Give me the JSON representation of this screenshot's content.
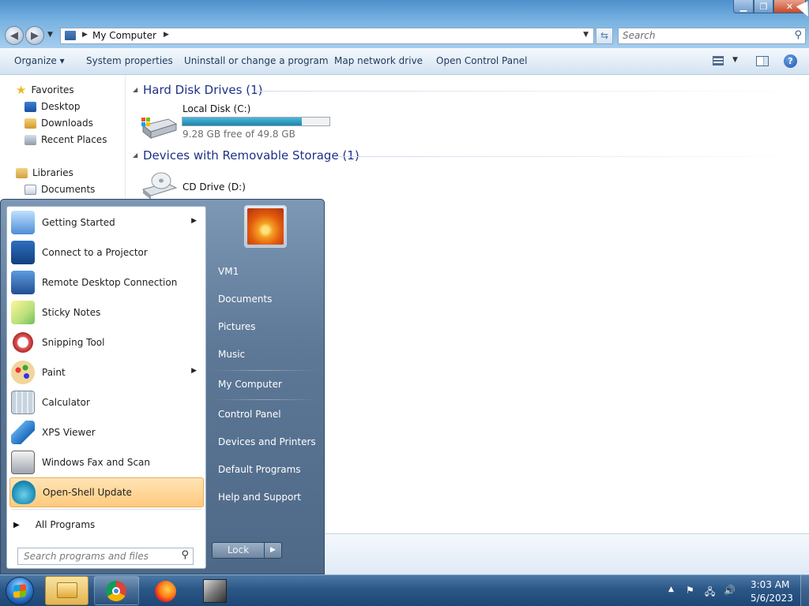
{
  "window": {
    "caption": {
      "minimize": "▁",
      "maximize": "❐",
      "close": "✕"
    },
    "address": {
      "text": "My Computer",
      "sep": "▶",
      "dropdown": "▼"
    },
    "search": {
      "placeholder": "Search"
    },
    "toolbar": {
      "organize": "Organize ▾",
      "system_properties": "System properties",
      "uninstall": "Uninstall or change a program",
      "map_drive": "Map network drive",
      "control_panel": "Open Control Panel"
    },
    "navpane": {
      "favorites": "Favorites",
      "desktop": "Desktop",
      "downloads": "Downloads",
      "recent": "Recent Places",
      "libraries": "Libraries",
      "documents": "Documents"
    },
    "content": {
      "hdd_header": "Hard Disk Drives (1)",
      "local_disk": "Local Disk (C:)",
      "local_disk_free": "9.28 GB free of 49.8 GB",
      "local_disk_used_fraction": 0.814,
      "removable_header": "Devices with Removable Storage (1)",
      "cd_drive": "CD Drive (D:)"
    }
  },
  "startmenu": {
    "programs": [
      {
        "label": "Getting Started",
        "has_submenu": true
      },
      {
        "label": "Connect to a Projector"
      },
      {
        "label": "Remote Desktop Connection"
      },
      {
        "label": "Sticky Notes"
      },
      {
        "label": "Snipping Tool"
      },
      {
        "label": "Paint",
        "has_submenu": true
      },
      {
        "label": "Calculator"
      },
      {
        "label": "XPS Viewer"
      },
      {
        "label": "Windows Fax and Scan"
      },
      {
        "label": "Open-Shell Update",
        "highlighted": true
      }
    ],
    "all_programs": "All Programs",
    "search_placeholder": "Search programs and files",
    "places": {
      "user": "VM1",
      "documents": "Documents",
      "pictures": "Pictures",
      "music": "Music",
      "computer": "My Computer",
      "control_panel": "Control Panel",
      "devices": "Devices and Printers",
      "default_programs": "Default Programs",
      "help": "Help and Support"
    },
    "lock": "Lock"
  },
  "taskbar": {
    "time": "3:03 AM",
    "date": "5/6/2023"
  }
}
